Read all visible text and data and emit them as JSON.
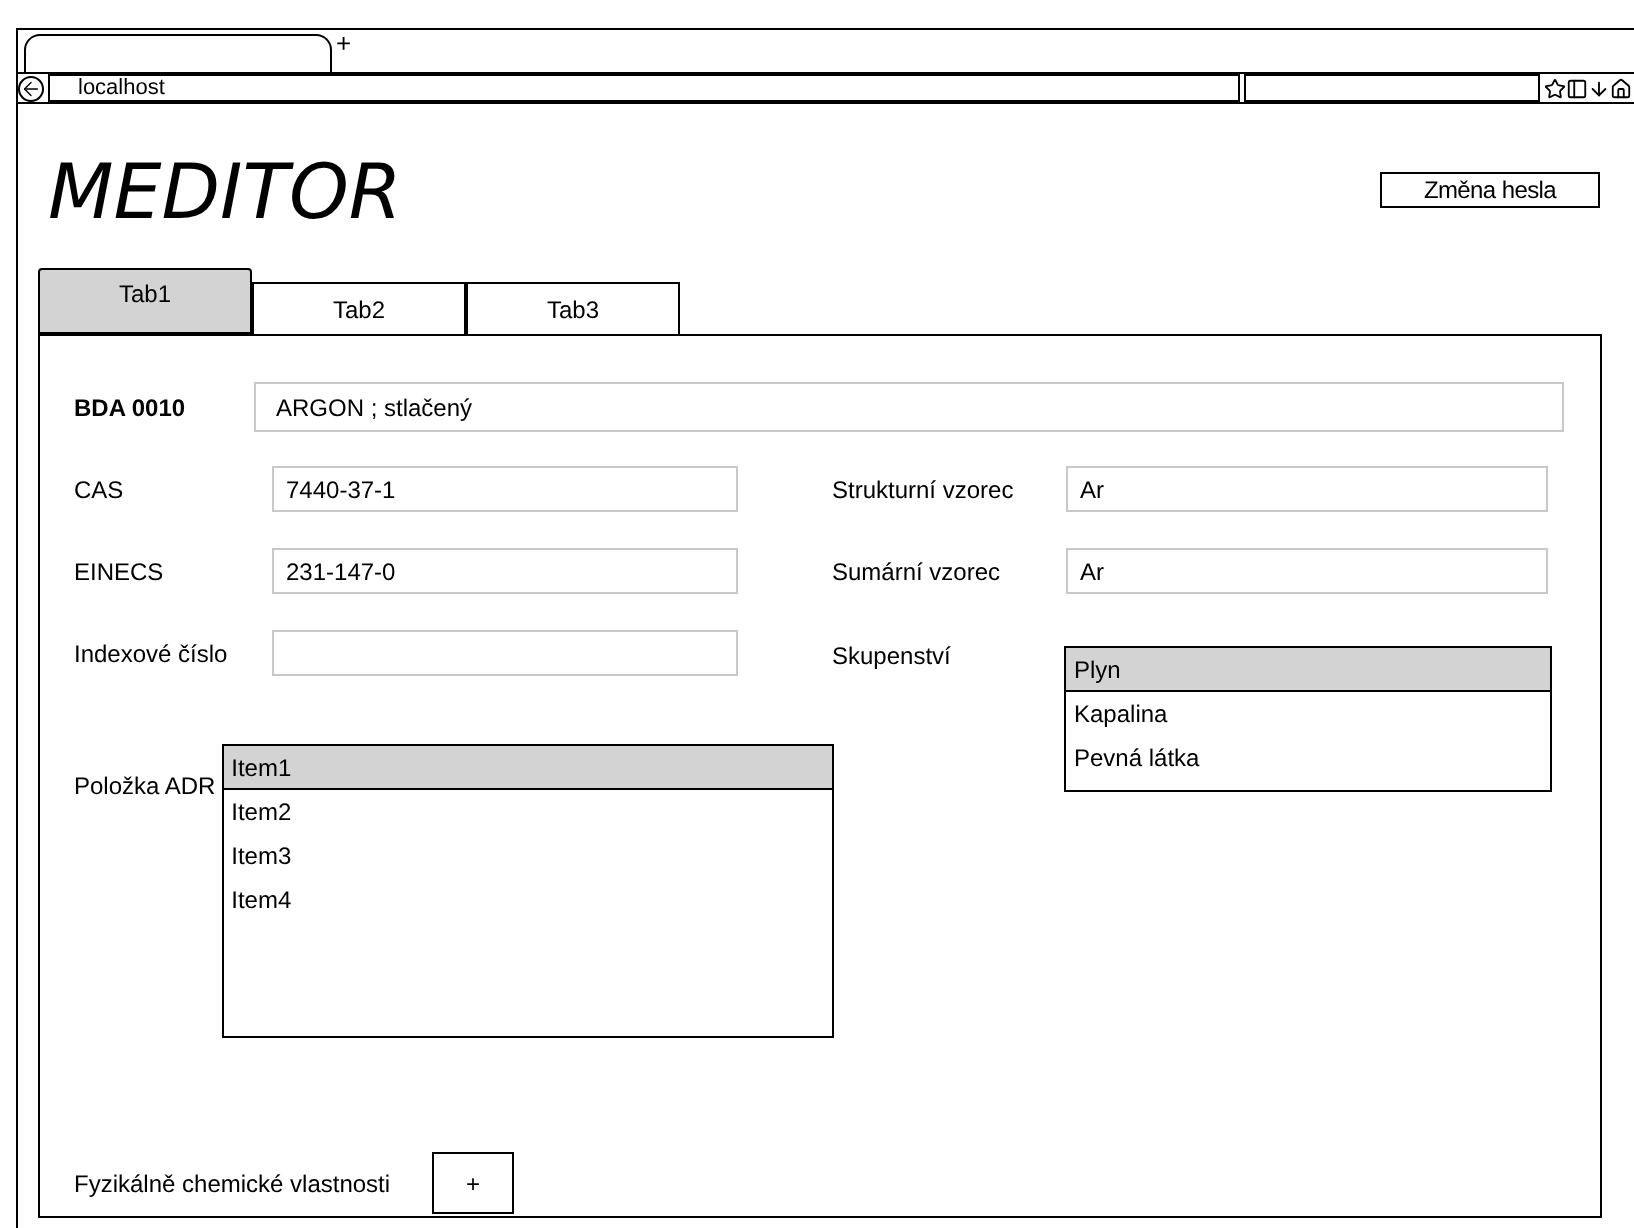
{
  "browser": {
    "new_tab": "+",
    "address": "localhost"
  },
  "app": {
    "title": "MEDITOR",
    "change_password": "Změna hesla"
  },
  "tabs": [
    {
      "label": "Tab1",
      "selected": true
    },
    {
      "label": "Tab2",
      "selected": false
    },
    {
      "label": "Tab3",
      "selected": false
    }
  ],
  "form": {
    "code_label": "BDA 0010",
    "name_value": "ARGON ; stlačený",
    "left_fields": [
      {
        "label": "CAS",
        "value": "7440-37-1"
      },
      {
        "label": "EINECS",
        "value": "231-147-0"
      },
      {
        "label": "Indexové číslo"
      }
    ],
    "right_fields": [
      {
        "label": "Strukturní vzorec",
        "value": "Ar"
      },
      {
        "label": "Sumární vzorec",
        "value": "Ar"
      }
    ],
    "state": {
      "label": "Skupenství",
      "options": [
        {
          "label": "Plyn",
          "selected": true
        },
        {
          "label": "Kapalina",
          "selected": false
        },
        {
          "label": "Pevná látka",
          "selected": false
        }
      ]
    },
    "adr": {
      "label": "Položka ADR",
      "items": [
        {
          "label": "Item1",
          "selected": true
        },
        {
          "label": "Item2",
          "selected": false
        },
        {
          "label": "Item3",
          "selected": false
        },
        {
          "label": "Item4",
          "selected": false
        }
      ]
    },
    "properties": {
      "label": "Fyzikálně chemické vlastnosti",
      "add_button": "+"
    }
  }
}
